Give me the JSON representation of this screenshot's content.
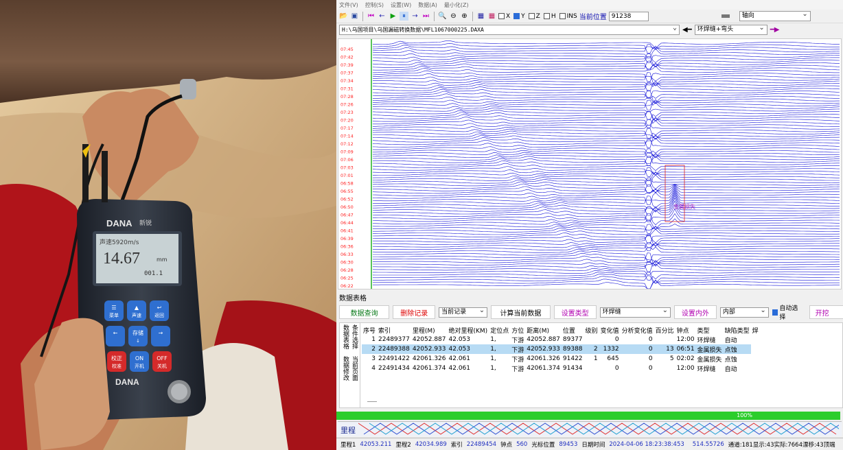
{
  "menu": [
    "文件(V)",
    "控制(S)",
    "设置(W)",
    "数据(A)",
    "最小化(Z)"
  ],
  "toolbar": {
    "checks": [
      {
        "label": "X",
        "on": false
      },
      {
        "label": "Y",
        "on": true
      },
      {
        "label": "Z",
        "on": false
      },
      {
        "label": "H",
        "on": false
      },
      {
        "label": "INS",
        "on": false
      }
    ],
    "pos_label": "当前位置",
    "pos_value": "91238",
    "axis_select": "轴向"
  },
  "path": {
    "value": "H:\\乌国项目\\乌国漏磁转换数据\\MFL1067000225.DAXA",
    "feature_select": "环焊缝+弯头"
  },
  "gauge": {
    "brand": "DANA",
    "brand_cn": "新锐",
    "velocity": "声速5920m/s",
    "reading": "14.67",
    "unit": "mm",
    "sub": "001.1",
    "buttons": [
      {
        "sym": "☰",
        "label": "菜单",
        "color": "blue"
      },
      {
        "sym": "▲",
        "label": "声速",
        "color": "blue"
      },
      {
        "sym": "↩",
        "label": "返回",
        "color": "blue"
      },
      {
        "sym": "←",
        "label": "",
        "color": "blue"
      },
      {
        "sym": "存储",
        "label": "↓",
        "color": "blue"
      },
      {
        "sym": "→",
        "label": "",
        "color": "blue"
      },
      {
        "sym": "校正",
        "label": "校准",
        "color": "red"
      },
      {
        "sym": "ON",
        "label": "开机",
        "color": "blue"
      },
      {
        "sym": "OFF",
        "label": "关机",
        "color": "red"
      }
    ]
  },
  "wave": {
    "time_labels": [
      "07:45",
      "07:42",
      "07:39",
      "07:37",
      "07:34",
      "07:31",
      "07:28",
      "07:26",
      "07:23",
      "07:20",
      "07:17",
      "07:14",
      "07:12",
      "07:09",
      "07:06",
      "07:03",
      "07:01",
      "06:58",
      "06:55",
      "06:52",
      "06:50",
      "06:47",
      "06:44",
      "06:41",
      "06:39",
      "06:36",
      "06:33",
      "06:30",
      "06:28",
      "06:25",
      "06:22"
    ],
    "defect_label": "金属损失"
  },
  "panel": {
    "tab_title": "数据表格",
    "buttons": {
      "query": "数据查询",
      "delete": "删除记录",
      "current": "当前记录",
      "calc": "计算当前数据",
      "settype": "设置类型",
      "type_value": "环焊缝",
      "setinout": "设置内外",
      "inout_value": "内部",
      "auto": "自动选择",
      "dig": "开挖"
    },
    "side_tabs": [
      "数据表格",
      "条件选择",
      "数据修改",
      "当前页面"
    ],
    "columns": [
      "序号",
      "索引",
      "里程(M)",
      "绝对里程(KM)",
      "定位点",
      "方位",
      "距离(M)",
      "位置",
      "级别",
      "变化值",
      "分析变化值",
      "百分比",
      "钟点",
      "类型",
      "缺陷类型",
      "焊"
    ],
    "rows": [
      [
        "1",
        "22489377",
        "42052.887",
        "42.053",
        "1,",
        "下游",
        "42052.887",
        "89377",
        "",
        "0",
        "0",
        "",
        "12:00",
        "环焊缝",
        "自动"
      ],
      [
        "2",
        "22489388",
        "42052.933",
        "42.053",
        "1,",
        "下游",
        "42052.933",
        "89388",
        "2",
        "1332",
        "0",
        "13",
        "06:51",
        "金属损失",
        "点蚀"
      ],
      [
        "3",
        "22491422",
        "42061.326",
        "42.061",
        "1,",
        "下游",
        "42061.326",
        "91422",
        "1",
        "645",
        "0",
        "5",
        "02:02",
        "金属损失",
        "点蚀"
      ],
      [
        "4",
        "22491434",
        "42061.374",
        "42.061",
        "1,",
        "下游",
        "42061.374",
        "91434",
        "",
        "0",
        "0",
        "",
        "12:00",
        "环焊缝",
        "自动"
      ]
    ],
    "selected_row": 1
  },
  "progress": "100%",
  "licheng_label": "里程",
  "status": [
    {
      "k": "里程1",
      "v": "42053.211"
    },
    {
      "k": "里程2",
      "v": "42034.989"
    },
    {
      "k": "索引",
      "v": "22489454"
    },
    {
      "k": "钟点",
      "v": "560"
    },
    {
      "k": "光标位置",
      "v": "89453"
    },
    {
      "k": "日期时间",
      "v": "2024-04-06 18:23:38:453"
    },
    {
      "k": "",
      "v": "514.55726"
    },
    {
      "k": "通道:181显示:43实际:7664漂移:43顶端",
      "v": ""
    }
  ],
  "colors": {
    "wave": "#1010d8",
    "accent": "#2a6cd8",
    "progress": "#2ccd2c",
    "timelabel": "#ff2020"
  }
}
